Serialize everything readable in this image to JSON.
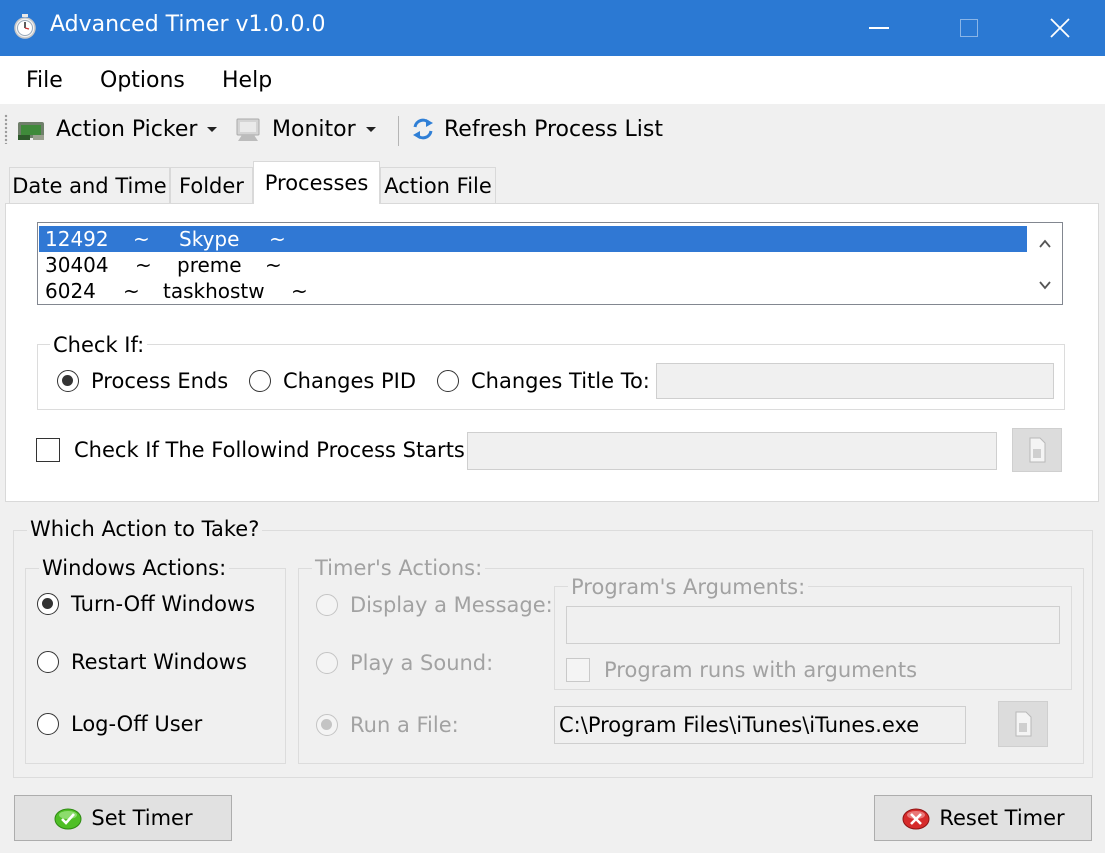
{
  "window": {
    "title": "Advanced Timer v1.0.0.0"
  },
  "menu": {
    "items": [
      "File",
      "Options",
      "Help"
    ]
  },
  "toolbar": {
    "action_picker": "Action Picker",
    "monitor": "Monitor",
    "refresh": "Refresh Process List"
  },
  "tabs": [
    "Date and Time",
    "Folder",
    "Processes",
    "Action File"
  ],
  "active_tab": "Processes",
  "processes": [
    {
      "pid": "12492",
      "sep1": "~",
      "name": "Skype",
      "sep2": "~",
      "selected": true
    },
    {
      "pid": "30404",
      "sep1": "~",
      "name": "preme",
      "sep2": "~",
      "selected": false
    },
    {
      "pid": "6024",
      "sep1": "~",
      "name": "taskhostw",
      "sep2": "~",
      "selected": false
    }
  ],
  "check_if": {
    "legend": "Check If:",
    "options": [
      "Process Ends",
      "Changes PID",
      "Changes Title To:"
    ],
    "selected": "Process Ends",
    "title_value": ""
  },
  "process_starts": {
    "label": "Check If The Followind Process Starts:",
    "checked": false,
    "value": ""
  },
  "actions": {
    "legend": "Which Action to Take?",
    "windows": {
      "legend": "Windows Actions:",
      "options": [
        "Turn-Off Windows",
        "Restart Windows",
        "Log-Off User"
      ],
      "selected": "Turn-Off Windows"
    },
    "timer": {
      "legend": "Timer's Actions:",
      "options": [
        "Display a Message:",
        "Play a Sound:",
        "Run a File:"
      ],
      "selected": "Run a File:",
      "enabled": false,
      "run_file_path": "C:\\Program Files\\iTunes\\iTunes.exe",
      "arguments": {
        "legend": "Program's Arguments:",
        "value": "",
        "checkbox_label": "Program runs with arguments",
        "checked": false
      }
    }
  },
  "buttons": {
    "set_timer": "Set Timer",
    "reset_timer": "Reset Timer"
  },
  "colors": {
    "titlebar": "#2b79d3",
    "selection": "#3078d4",
    "set_timer_icon": "#4fbf26",
    "reset_timer_icon": "#d62b2b"
  }
}
